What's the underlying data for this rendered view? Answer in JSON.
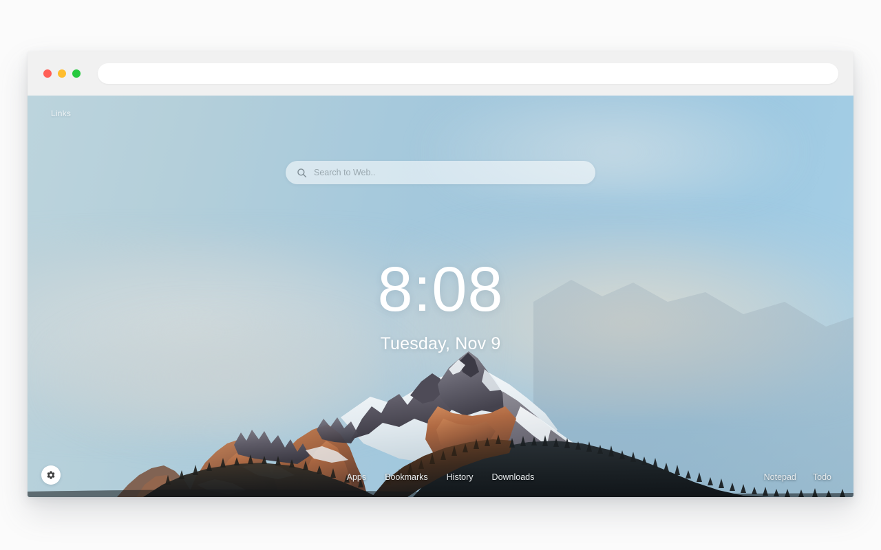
{
  "window": {
    "traffic_lights": [
      {
        "name": "close",
        "color": "#ff5f56"
      },
      {
        "name": "minimize",
        "color": "#ffbd2e"
      },
      {
        "name": "maximize",
        "color": "#27c93f"
      }
    ],
    "url_bar": {
      "value": "",
      "placeholder": ""
    }
  },
  "page": {
    "links_label": "Links",
    "search": {
      "icon": "search-icon",
      "value": "",
      "placeholder": "Search to Web.."
    },
    "clock": {
      "time": "8:08",
      "date": "Tuesday, Nov 9"
    },
    "settings": {
      "icon": "gear-icon",
      "label": "Settings"
    },
    "nav_center": [
      {
        "label": "Apps"
      },
      {
        "label": "Bookmarks"
      },
      {
        "label": "History"
      },
      {
        "label": "Downloads"
      }
    ],
    "nav_right": [
      {
        "label": "Notepad"
      },
      {
        "label": "Todo"
      }
    ]
  },
  "theme": {
    "sky_light": "#bcd4dd",
    "sky_blue": "#9ec9e2",
    "haze_warm": "#f0e2cd",
    "rock_lit": "#b56a45",
    "rock_shadow": "#5b5660",
    "snow": "#eef3f6",
    "forest_dark": "#26282b",
    "text_on_photo": "#e8ecee"
  }
}
